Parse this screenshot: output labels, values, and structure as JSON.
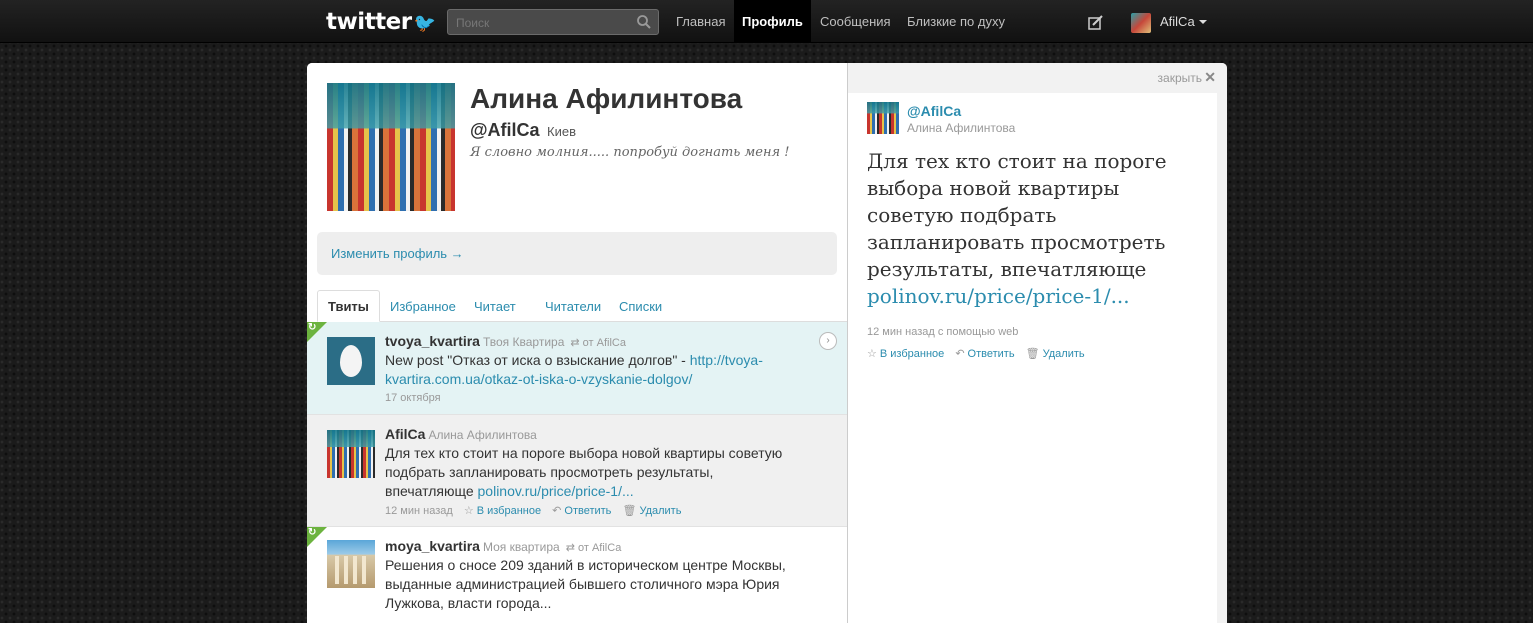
{
  "topbar": {
    "logo": "twitter",
    "search_placeholder": "Поиск",
    "nav": [
      "Главная",
      "Профиль",
      "Сообщения",
      "Близкие по духу"
    ],
    "user": "AfilCa"
  },
  "profile": {
    "name": "Алина Афилинтова",
    "handle": "@AfilCa",
    "location": "Киев",
    "bio": "Я словно молния..... попробуй догнать меня !",
    "edit_profile": "Изменить профиль →"
  },
  "tabs": [
    "Твиты",
    "Избранное",
    "Читает",
    "Читатели",
    "Списки"
  ],
  "tweets": [
    {
      "user": "tvoya_kvartira",
      "fullname": "Твоя Квартира",
      "retweet_by": "от AfilCa",
      "text": "New post \"Отказ от иска о взыскание долгов\" - ",
      "link": "http://tvoya-kvartira.com.ua/otkaz-ot-iska-o-vzyskanie-dolgov/",
      "time": "17 октября"
    },
    {
      "user": "AfilCa",
      "fullname": "Алина Афилинтова",
      "text": "Для тех кто стоит на пороге выбора новой квартиры советую подбрать запланировать просмотреть результаты, впечатляюще ",
      "link": "polinov.ru/price/price-1/...",
      "time": "12 мин назад",
      "fav": "В избранное",
      "reply": "Ответить",
      "delete": "Удалить"
    },
    {
      "user": "moya_kvartira",
      "fullname": "Моя квартира",
      "retweet_by": "от AfilCa",
      "text": "Решения о сносе 209 зданий в историческом центре Москвы, выданные администрацией бывшего столичного мэра Юрия Лужкова, власти города..."
    }
  ],
  "detail": {
    "close": "закрыть",
    "user": "@AfilCa",
    "fullname": "Алина Афилинтова",
    "text": "Для тех кто стоит на пороге выбора новой квартиры советую подбрать запланировать просмотреть результаты, впечатляюще ",
    "link": "polinov.ru/price/price-1/...",
    "time": "12 мин назад с помощью web",
    "fav": "В избранное",
    "reply": "Ответить",
    "delete": "Удалить"
  },
  "colors": {
    "link": "#2b8cae",
    "highlight": "#e4f3f4",
    "retweet_corner": "#6cb33f"
  },
  "icons": [
    "search-icon",
    "compose-icon",
    "retweet-icon",
    "star-icon",
    "reply-icon",
    "trash-icon",
    "close-icon",
    "arrow-icon"
  ]
}
